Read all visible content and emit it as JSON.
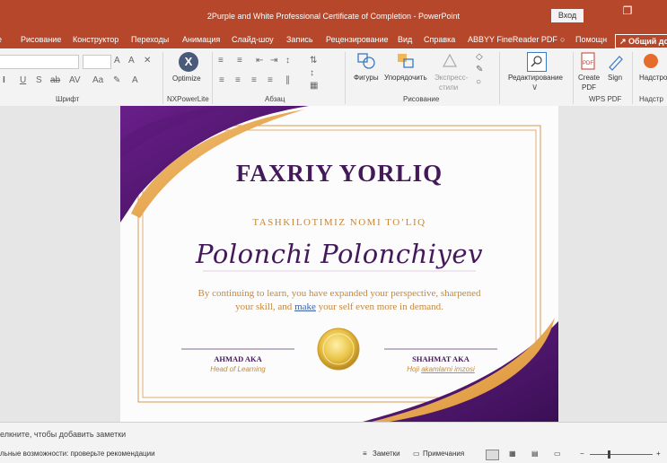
{
  "window": {
    "title": "2Purple and White Professional Certificate of Completion  -  PowerPoint",
    "login_label": "Вход"
  },
  "tabs": [
    "Рисование",
    "Конструктор",
    "Переходы",
    "Анимация",
    "Слайд-шоу",
    "Запись",
    "Рецензирование",
    "Вид",
    "Справка",
    "ABBYY FineReader PDF",
    "Помощн",
    "Общий до"
  ],
  "ribbon": {
    "groups": {
      "font": "Шрифт",
      "nxpower": "NXPowerLite",
      "paragraph": "Абзац",
      "drawing": "Рисование",
      "wpspdf": "WPS PDF",
      "addins": "Надстр"
    },
    "buttons": {
      "optimize": "Optimize",
      "shapes": "Фигуры",
      "arrange": "Упорядочить",
      "quickstyles_1": "Экспресс-",
      "quickstyles_2": "стили",
      "editing": "Редактирование",
      "create_pdf_1": "Create",
      "create_pdf_2": "PDF",
      "sign": "Sign",
      "addins": "Надстро"
    }
  },
  "certificate": {
    "title": "FAXRIY YORLIQ",
    "subtitle": "TASHKILOTIMIZ NOMI TO’LIQ",
    "recipient": "Polonchi Polonchiyev",
    "body_line1": "By continuing to learn, you have expanded your perspective, sharpened",
    "body_line2_a": "your skill, and ",
    "body_line2_b": "make",
    "body_line2_c": " your self even more in demand.",
    "left_sig_name": "AHMAD AKA",
    "left_sig_role": "Head of Learning",
    "right_sig_name": "SHAHMAT AKA",
    "right_sig_role_a": "Hoji ",
    "right_sig_role_b": "akamlarni imzosi"
  },
  "colors": {
    "accent": "#b7472a",
    "purple": "#43195a",
    "gold": "#c2883e"
  },
  "notes": {
    "placeholder": "елкните, чтобы добавить заметки"
  },
  "status": {
    "accessibility": "льные возможности: проверьте рекомендации",
    "notes": "Заметки",
    "comments": "Примечания"
  }
}
